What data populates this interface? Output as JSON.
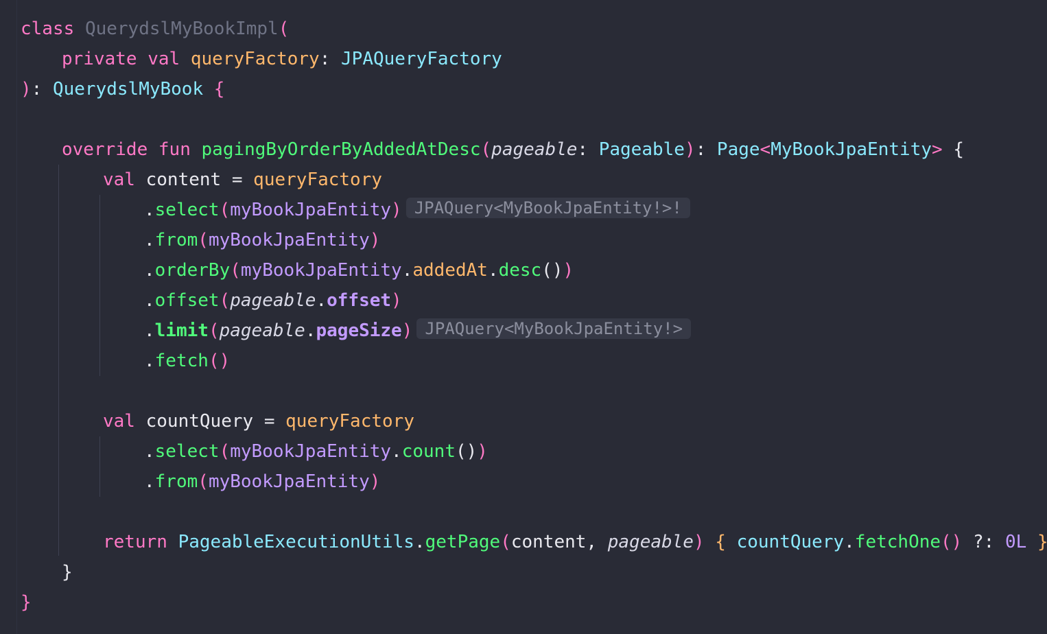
{
  "code": {
    "l1": {
      "kw": "class",
      "name": "QuerydslMyBookImpl",
      "paren": "("
    },
    "l2": {
      "kw_private": "private",
      "kw_val": "val",
      "prop": "queryFactory",
      "colon": ": ",
      "type": "JPAQueryFactory"
    },
    "l3": {
      "paren": ")",
      "colon": ": ",
      "type": "QuerydslMyBook",
      "brace": "{"
    },
    "l5": {
      "kw_override": "override",
      "kw_fun": "fun",
      "fn": "pagingByOrderByAddedAtDesc",
      "paren_open": "(",
      "param": "pageable",
      "colon1": ": ",
      "ptype": "Pageable",
      "paren_close": ")",
      "colon2": ": ",
      "rtype": "Page",
      "lt": "<",
      "gtype": "MyBookJpaEntity",
      "gt": ">",
      "brace": "{"
    },
    "l6": {
      "kw": "val",
      "var": "content",
      "eq": " = ",
      "prop": "queryFactory"
    },
    "l7": {
      "dot": ".",
      "fn": "select",
      "po": "(",
      "arg": "myBookJpaEntity",
      "pc": ")",
      "hint": "JPAQuery<MyBookJpaEntity!>!"
    },
    "l8": {
      "dot": ".",
      "fn": "from",
      "po": "(",
      "arg": "myBookJpaEntity",
      "pc": ")"
    },
    "l9": {
      "dot": ".",
      "fn": "orderBy",
      "po": "(",
      "arg": "myBookJpaEntity",
      "dot2": ".",
      "prop": "addedAt",
      "dot3": ".",
      "fn2": "desc",
      "call": "()",
      "pc": ")"
    },
    "l10": {
      "dot": ".",
      "fn": "offset",
      "po": "(",
      "param": "pageable",
      "dot2": ".",
      "ref": "offset",
      "pc": ")"
    },
    "l11": {
      "dot": ".",
      "fn": "limit",
      "po": "(",
      "param": "pageable",
      "dot2": ".",
      "ref": "pageSize",
      "pc": ")",
      "hint": "JPAQuery<MyBookJpaEntity!>"
    },
    "l12": {
      "dot": ".",
      "fn": "fetch",
      "call": "()"
    },
    "l14": {
      "kw": "val",
      "var": "countQuery",
      "eq": " = ",
      "prop": "queryFactory"
    },
    "l15": {
      "dot": ".",
      "fn": "select",
      "po": "(",
      "arg": "myBookJpaEntity",
      "dot2": ".",
      "fn2": "count",
      "call": "()",
      "pc": ")"
    },
    "l16": {
      "dot": ".",
      "fn": "from",
      "po": "(",
      "arg": "myBookJpaEntity",
      "pc": ")"
    },
    "l18": {
      "kw": "return",
      "type": "PageableExecutionUtils",
      "dot": ".",
      "fn": "getPage",
      "po": "(",
      "arg1": "content",
      "comma": ", ",
      "param": "pageable",
      "pc": ")",
      "bo": "{",
      "var": "countQuery",
      "dot2": ".",
      "fn2": "fetchOne",
      "call": "()",
      "elvis": " ?: ",
      "num": "0L",
      "bc": "}"
    },
    "l19": {
      "brace": "}"
    },
    "l20": {
      "brace": "}"
    }
  },
  "colors": {
    "background": "#292b36",
    "keyword": "#ff79c6",
    "type": "#8be9fd",
    "property": "#ffb86c",
    "function": "#50fa7b",
    "reference": "#c39bff"
  }
}
